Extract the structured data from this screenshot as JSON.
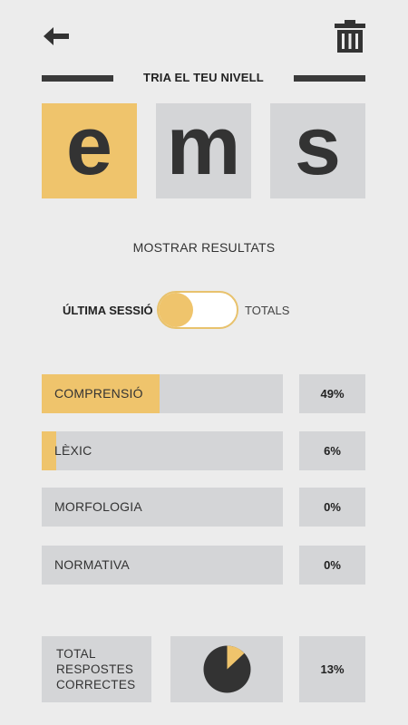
{
  "header": {
    "back_icon": "arrow-left-icon",
    "delete_icon": "trash-icon",
    "title": "TRIA EL TEU NIVELL"
  },
  "levels": [
    {
      "letter": "e",
      "selected": true
    },
    {
      "letter": "m",
      "selected": false
    },
    {
      "letter": "s",
      "selected": false
    }
  ],
  "show_results_label": "MOSTRAR RESULTATS",
  "toggle": {
    "left_label": "ÚLTIMA SESSIÓ",
    "right_label": "TOTALS",
    "state": "left"
  },
  "results": [
    {
      "label": "COMPRENSIÓ",
      "value": 0.49,
      "percent_text": "49%"
    },
    {
      "label": "LÈXIC",
      "value": 0.06,
      "percent_text": "6%"
    },
    {
      "label": "MORFOLOGIA",
      "value": 0.0,
      "percent_text": "0%"
    },
    {
      "label": "NORMATIVA",
      "value": 0.0,
      "percent_text": "0%"
    }
  ],
  "totals": {
    "label_lines": [
      "TOTAL",
      "RESPOSTES",
      "CORRECTES"
    ],
    "value": 0.13,
    "percent_text": "13%"
  },
  "colors": {
    "accent": "#efc46c",
    "tile_inactive": "#d4d5d7",
    "dark": "#333333",
    "background": "#ececec"
  }
}
